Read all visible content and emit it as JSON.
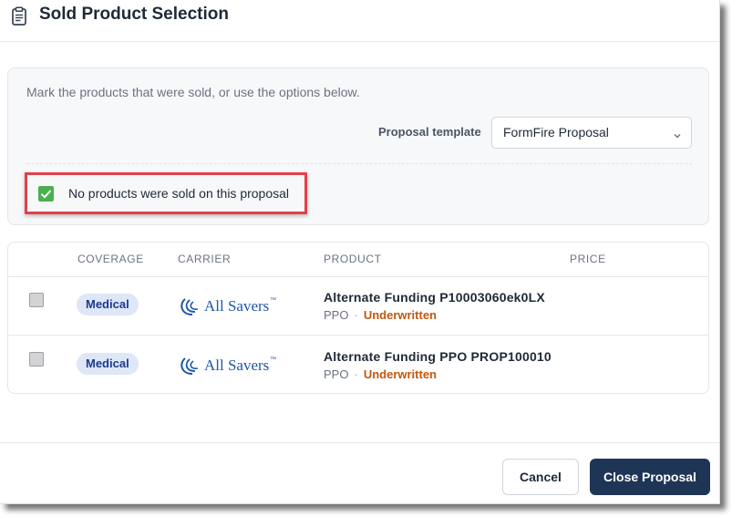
{
  "dialog": {
    "title": "Sold Product Selection",
    "icon": "clipboard-icon"
  },
  "options": {
    "intro": "Mark the products that were sold, or use the options below.",
    "template_label": "Proposal template",
    "template_value": "FormFire Proposal",
    "no_products_label": "No products were sold on this proposal",
    "no_products_checked": true
  },
  "table": {
    "headers": [
      "COVERAGE",
      "CARRIER",
      "PRODUCT",
      "PRICE"
    ],
    "rows": [
      {
        "checked": false,
        "coverage": "Medical",
        "carrier": "All Savers",
        "carrier_mark": "™",
        "product": "Alternate Funding P10003060ek0LX",
        "plan_type": "PPO",
        "separator": "·",
        "status": "Underwritten"
      },
      {
        "checked": false,
        "coverage": "Medical",
        "carrier": "All Savers",
        "carrier_mark": "™",
        "product": "Alternate Funding PPO PROP100010",
        "plan_type": "PPO",
        "separator": "·",
        "status": "Underwritten"
      }
    ]
  },
  "footer": {
    "cancel_label": "Cancel",
    "close_label": "Close Proposal"
  },
  "colors": {
    "primary_button": "#1f3556",
    "checked_green": "#4caf50",
    "highlight_red": "#e2404a",
    "status_orange": "#c2570c",
    "badge_bg": "#dde7f7",
    "carrier_blue": "#1e56a6"
  }
}
